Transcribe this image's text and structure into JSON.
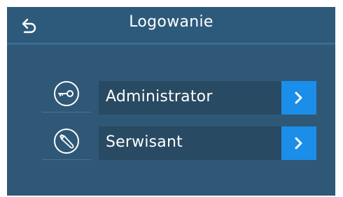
{
  "header": {
    "title": "Logowanie",
    "back_icon": "back-arrow-icon"
  },
  "login_options": [
    {
      "label": "Administrator",
      "icon": "key-icon",
      "arrow_icon": "chevron-right-icon"
    },
    {
      "label": "Serwisant",
      "icon": "wrench-icon",
      "arrow_icon": "chevron-right-icon"
    }
  ],
  "colors": {
    "background": "#2f5877",
    "row_background": "#294a63",
    "arrow_button": "#1a8ee8",
    "text": "#ffffff"
  }
}
